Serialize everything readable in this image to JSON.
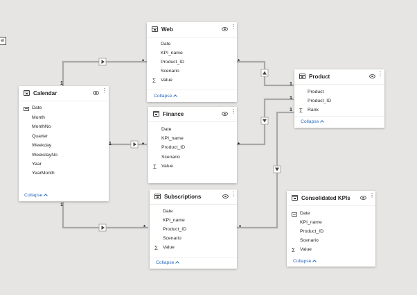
{
  "left_tab": {
    "label": "el"
  },
  "collapse_label": "Collapse",
  "cardinality": {
    "one": "1",
    "many": "*"
  },
  "tables": {
    "calendar": {
      "title": "Calendar",
      "fields": [
        {
          "name": "Date",
          "icon": "date-icon"
        },
        {
          "name": "Month",
          "icon": ""
        },
        {
          "name": "MonthNo",
          "icon": ""
        },
        {
          "name": "Quarter",
          "icon": ""
        },
        {
          "name": "Weekday",
          "icon": ""
        },
        {
          "name": "WeekdayNo",
          "icon": ""
        },
        {
          "name": "Year",
          "icon": ""
        },
        {
          "name": "YearMonth",
          "icon": ""
        }
      ]
    },
    "web": {
      "title": "Web",
      "fields": [
        {
          "name": "Date",
          "icon": ""
        },
        {
          "name": "KPI_name",
          "icon": ""
        },
        {
          "name": "Product_ID",
          "icon": ""
        },
        {
          "name": "Scenario",
          "icon": ""
        },
        {
          "name": "Value",
          "icon": "sigma-icon"
        }
      ]
    },
    "finance": {
      "title": "Finance",
      "fields": [
        {
          "name": "Date",
          "icon": ""
        },
        {
          "name": "KPI_name",
          "icon": ""
        },
        {
          "name": "Product_ID",
          "icon": ""
        },
        {
          "name": "Scenario",
          "icon": ""
        },
        {
          "name": "Value",
          "icon": "sigma-icon"
        }
      ]
    },
    "subscriptions": {
      "title": "Subscriptions",
      "fields": [
        {
          "name": "Date",
          "icon": ""
        },
        {
          "name": "KPI_name",
          "icon": ""
        },
        {
          "name": "Product_ID",
          "icon": ""
        },
        {
          "name": "Scenario",
          "icon": ""
        },
        {
          "name": "Value",
          "icon": "sigma-icon"
        }
      ]
    },
    "product": {
      "title": "Product",
      "fields": [
        {
          "name": "Product",
          "icon": ""
        },
        {
          "name": "Product_ID",
          "icon": ""
        },
        {
          "name": "Rank",
          "icon": "sigma-icon"
        }
      ]
    },
    "consolidated": {
      "title": "Consolidated KPIs",
      "fields": [
        {
          "name": "Date",
          "icon": "date-icon"
        },
        {
          "name": "KPI_name",
          "icon": ""
        },
        {
          "name": "Product_ID",
          "icon": ""
        },
        {
          "name": "Scenario",
          "icon": ""
        },
        {
          "name": "Value",
          "icon": "sigma-icon"
        }
      ]
    }
  },
  "colors": {
    "canvas": "#e6e5e3",
    "card": "#ffffff",
    "link": "#2b6bbd",
    "connector": "#a8a8a8"
  }
}
